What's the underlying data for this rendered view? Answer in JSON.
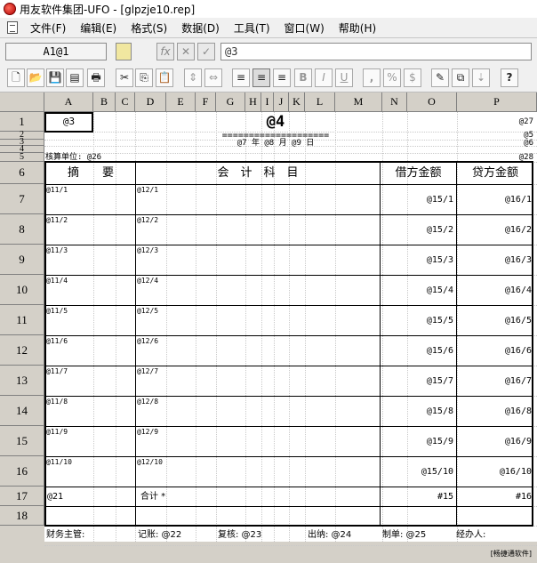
{
  "window": {
    "title": "用友软件集团-UFO - [glpzje10.rep]"
  },
  "menu": [
    "文件(F)",
    "编辑(E)",
    "格式(S)",
    "数据(D)",
    "工具(T)",
    "窗口(W)",
    "帮助(H)"
  ],
  "editbar": {
    "cell_ref": "A1@1",
    "fx": "fx",
    "cancel": "✕",
    "confirm": "✓",
    "formula": "@3"
  },
  "toolbar_glyphs": {
    "new": "🗋",
    "open": "📂",
    "save": "💾",
    "print": "🖶",
    "cut": "✂",
    "copy": "⎘",
    "paste": "📋",
    "row_height": "⇕",
    "col_width": "⇔",
    "align_left": "≡",
    "align_center": "≡",
    "align_right": "≡",
    "bold": "B",
    "italic": "I",
    "underline": "U",
    "comma": ",",
    "percent": "%",
    "currency": "$",
    "wizard": "✎",
    "group": "⧉",
    "sort": "⇣",
    "help": "?"
  },
  "sheet": {
    "columns": [
      "A",
      "B",
      "C",
      "D",
      "E",
      "F",
      "G",
      "H",
      "I",
      "J",
      "K",
      "L",
      "M",
      "N",
      "O",
      "P"
    ],
    "rows": [
      "1",
      "2",
      "3",
      "4",
      "5",
      "6",
      "7",
      "8",
      "9",
      "10",
      "11",
      "12",
      "13",
      "14",
      "15",
      "16",
      "17",
      "18"
    ],
    "a1": "@3",
    "title": "@4",
    "p1": "@27",
    "p2": "@5",
    "p3": "@6",
    "underline": "====================",
    "date_line": "@7 年 @8 月 @9 日",
    "unit_label": "核算单位: @26",
    "p4": "@28",
    "headers": {
      "summary": "摘　　要",
      "account": "会　计　科　目",
      "debit": "借方金额",
      "credit": "贷方金额"
    },
    "entries": [
      {
        "summary": "@11/1",
        "account": "@12/1",
        "debit": "@15/1",
        "credit": "@16/1"
      },
      {
        "summary": "@11/2",
        "account": "@12/2",
        "debit": "@15/2",
        "credit": "@16/2"
      },
      {
        "summary": "@11/3",
        "account": "@12/3",
        "debit": "@15/3",
        "credit": "@16/3"
      },
      {
        "summary": "@11/4",
        "account": "@12/4",
        "debit": "@15/4",
        "credit": "@16/4"
      },
      {
        "summary": "@11/5",
        "account": "@12/5",
        "debit": "@15/5",
        "credit": "@16/5"
      },
      {
        "summary": "@11/6",
        "account": "@12/6",
        "debit": "@15/6",
        "credit": "@16/6"
      },
      {
        "summary": "@11/7",
        "account": "@12/7",
        "debit": "@15/7",
        "credit": "@16/7"
      },
      {
        "summary": "@11/8",
        "account": "@12/8",
        "debit": "@15/8",
        "credit": "@16/8"
      },
      {
        "summary": "@11/9",
        "account": "@12/9",
        "debit": "@15/9",
        "credit": "@16/9"
      },
      {
        "summary": "@11/10",
        "account": "@12/10",
        "debit": "@15/10",
        "credit": "@16/10"
      }
    ],
    "total": {
      "a": "@21",
      "label": "合计 *",
      "debit": "#15",
      "credit": "#16"
    },
    "footer": {
      "supervisor": "财务主管:",
      "bookkeeper": "记账: @22",
      "reviewer": "复核: @23",
      "cashier": "出纳: @24",
      "preparer": "制单: @25",
      "handler": "经办人:",
      "vendor": "[畅捷通软件]"
    }
  }
}
